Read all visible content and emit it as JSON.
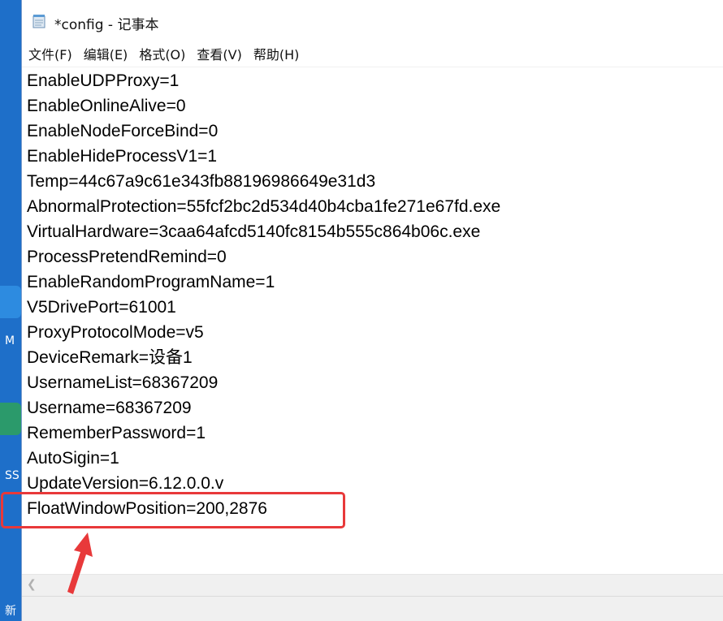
{
  "window": {
    "title": "*config - 记事本"
  },
  "menu": [
    {
      "label": "文件(F)"
    },
    {
      "label": "编辑(E)"
    },
    {
      "label": "格式(O)"
    },
    {
      "label": "查看(V)"
    },
    {
      "label": "帮助(H)"
    }
  ],
  "lines": [
    "EnableUDPProxy=1",
    "EnableOnlineAlive=0",
    "EnableNodeForceBind=0",
    "EnableHideProcessV1=1",
    "Temp=44c67a9c61e343fb88196986649e31d3",
    "AbnormalProtection=55fcf2bc2d534d40b4cba1fe271e67fd.exe",
    "VirtualHardware=3caa64afcd5140fc8154b555c864b06c.exe",
    "ProcessPretendRemind=0",
    "EnableRandomProgramName=1",
    "V5DrivePort=61001",
    "ProxyProtocolMode=v5",
    "DeviceRemark=设备1",
    "UsernameList=68367209",
    "Username=68367209",
    "RememberPassword=1",
    "AutoSigin=1",
    "UpdateVersion=6.12.0.0.v",
    "FloatWindowPosition=200,2876"
  ],
  "desktop": {
    "labels": [
      "M",
      "SS",
      "新"
    ]
  },
  "colors": {
    "highlight": "#e8393a",
    "desktop": "#1e6fc9"
  }
}
